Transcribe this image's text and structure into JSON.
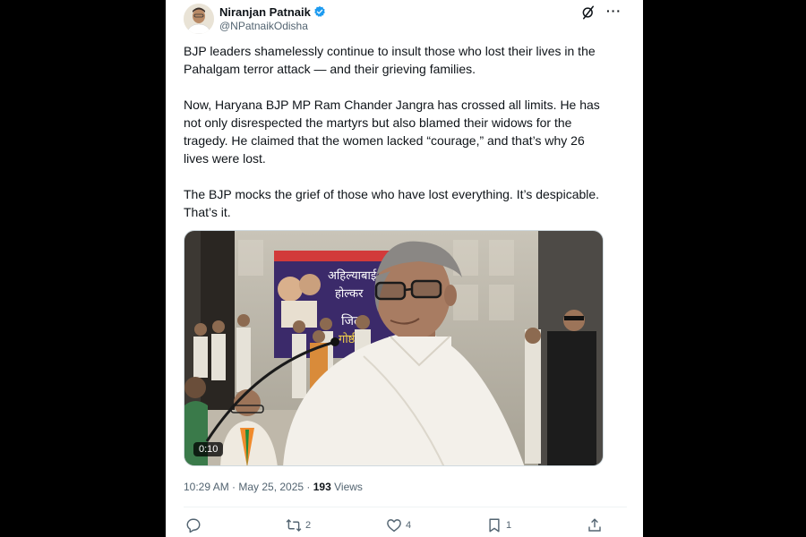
{
  "author": {
    "name": "Niranjan Patnaik",
    "handle": "@NPatnaikOdisha"
  },
  "icons": {
    "verified": "verified-badge-icon",
    "grok": "grok-icon",
    "more": "more-options-icon",
    "reply": "reply-icon",
    "repost": "repost-icon",
    "like": "like-icon",
    "bookmark": "bookmark-icon",
    "share": "share-icon"
  },
  "colors": {
    "verified": "#1d9bf0",
    "text": "#0f1419",
    "secondary": "#536471"
  },
  "tweet": {
    "paragraphs": [
      "BJP leaders shamelessly continue to insult those who lost their lives in the Pahalgam terror attack — and their grieving families.",
      "Now, Haryana BJP MP Ram Chander Jangra has crossed all limits. He has not only disrespected the martyrs but also blamed their widows for the tragedy. He claimed that the women lacked “courage,” and that’s why 26 lives were lost.",
      "The BJP mocks the grief of those who have lost everything. It’s despicable. That’s it."
    ]
  },
  "media": {
    "duration": "0:10",
    "banner_lines": [
      "अहिल्याबाई",
      "होल्कर",
      "जिला",
      "गोष्ठी"
    ]
  },
  "meta": {
    "timestamp": "10:29 AM · May 25, 2025 · ",
    "views_count": "193",
    "views_label": " Views"
  },
  "actions": {
    "reposts": "2",
    "likes": "4",
    "bookmarks": "1"
  }
}
